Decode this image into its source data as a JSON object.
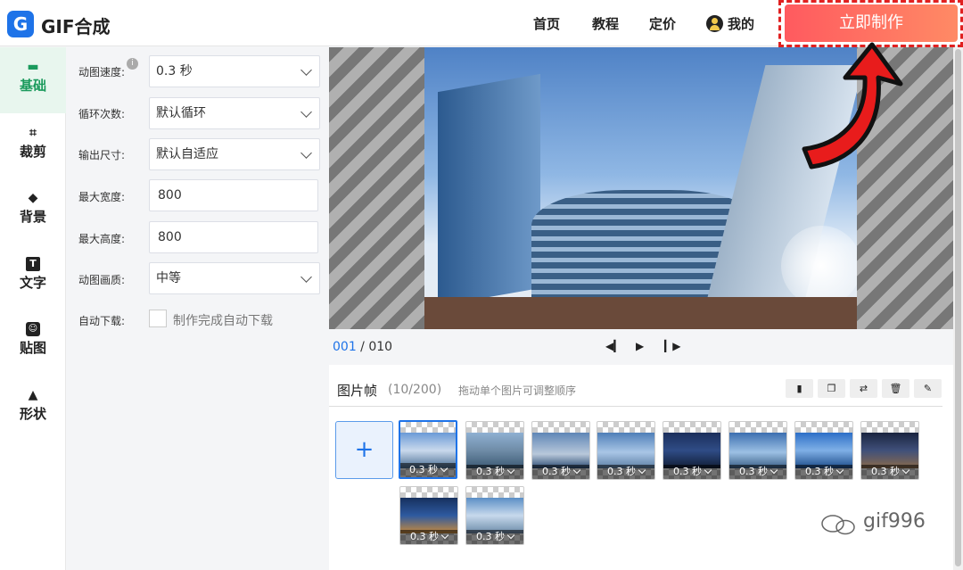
{
  "header": {
    "logo_letter": "G",
    "brand": "GIF合成",
    "nav": [
      "首页",
      "教程",
      "定价",
      "我的"
    ],
    "cta_label": "立即制作",
    "cta_color": "#ff6b5f"
  },
  "sidebar": {
    "items": [
      {
        "label": "基础",
        "icon": "folder-icon",
        "active": true
      },
      {
        "label": "裁剪",
        "icon": "crop-icon"
      },
      {
        "label": "背景",
        "icon": "paint-bucket-icon"
      },
      {
        "label": "文字",
        "icon": "text-icon"
      },
      {
        "label": "贴图",
        "icon": "sticker-icon"
      },
      {
        "label": "形状",
        "icon": "triangle-icon"
      }
    ]
  },
  "settings": {
    "speed_label": "动图速度:",
    "speed_value": "0.3 秒",
    "loop_label": "循环次数:",
    "loop_value": "默认循环",
    "size_label": "输出尺寸:",
    "size_value": "默认自适应",
    "max_width_label": "最大宽度:",
    "max_width_value": "800",
    "max_height_label": "最大高度:",
    "max_height_value": "800",
    "quality_label": "动图画质:",
    "quality_value": "中等",
    "auto_download_label": "自动下载:",
    "auto_download_text": "制作完成自动下载"
  },
  "player": {
    "current": "001",
    "separator": " / ",
    "total": "010"
  },
  "frames": {
    "title": "图片帧",
    "count": "(10/200)",
    "hint": "拖动单个图片可调整顺序",
    "add_label": "+",
    "items": [
      {
        "label": "0.3 秒"
      },
      {
        "label": "0.3 秒"
      },
      {
        "label": "0.3 秒"
      },
      {
        "label": "0.3 秒"
      },
      {
        "label": "0.3 秒"
      },
      {
        "label": "0.3 秒"
      },
      {
        "label": "0.3 秒"
      },
      {
        "label": "0.3 秒"
      },
      {
        "label": "0.3 秒"
      },
      {
        "label": "0.3 秒"
      }
    ]
  },
  "watermark": "gif996"
}
